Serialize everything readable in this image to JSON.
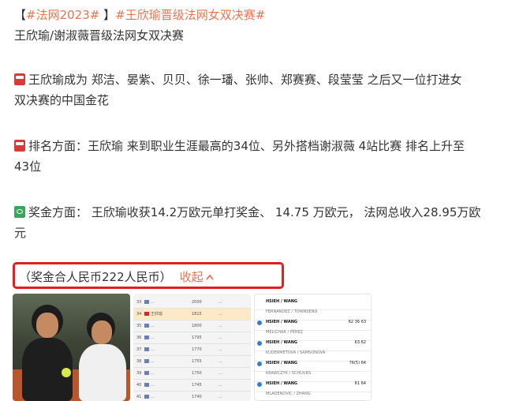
{
  "post": {
    "tag_open": "【",
    "tag_1": "#法网2023#",
    "tag_close": "】",
    "tag_2": "#王欣瑜晋级法网女双决赛#",
    "headline": "王欣瑜/谢淑薇晋级法网女双决赛",
    "para1_line1": "王欣瑜成为 郑洁、晏紫、贝贝、徐一璠、张帅、郑赛赛、段莹莹 之后又一位打进女",
    "para1_line2": "双决赛的中国金花",
    "para2_line1": "排名方面：王欣瑜 来到职业生涯最高的34位、另外搭档谢淑薇 4站比赛 排名上升至",
    "para2_line2": "43位",
    "para3_line1": "奖金方面： 王欣瑜收获14.2万欧元单打奖金、 14.75 万欧元， 法网总收入28.95万欧",
    "para3_line2": "元",
    "note": "（奖金合人民币222人民币）",
    "collapse_label": "收起",
    "icons": {
      "para1": "red-bookmark-icon",
      "para2": "red-bookmark-icon",
      "para3": "money-icon",
      "collapse": "chevron-up-icon"
    },
    "colors": {
      "link": "#eb7350",
      "highlight_box": "#e02020",
      "text": "#333333"
    }
  },
  "thumbnails": {
    "ranking": {
      "rows": [
        {
          "rank": "33",
          "name": "...",
          "pts": "2000",
          "note": "..."
        },
        {
          "rank": "34",
          "name": "王欣瑜",
          "pts": "1815",
          "note": "...",
          "highlight": true
        },
        {
          "rank": "35",
          "name": "...",
          "pts": "1800",
          "note": "..."
        },
        {
          "rank": "36",
          "name": "...",
          "pts": "1795",
          "note": "..."
        },
        {
          "rank": "37",
          "name": "...",
          "pts": "1770",
          "note": "..."
        },
        {
          "rank": "38",
          "name": "...",
          "pts": "1755",
          "note": "..."
        },
        {
          "rank": "39",
          "name": "...",
          "pts": "1750",
          "note": "..."
        },
        {
          "rank": "40",
          "name": "...",
          "pts": "1745",
          "note": "..."
        },
        {
          "rank": "41",
          "name": "...",
          "pts": "1740",
          "note": "..."
        }
      ]
    },
    "results": {
      "rows": [
        {
          "team": "HSIEH / WANG",
          "score": "",
          "bold": true,
          "check": false
        },
        {
          "team": "FERNANDEZ / TOWNSEND",
          "score": "",
          "bold": false,
          "check": false
        },
        {
          "team": "HSIEH / WANG",
          "score": "62 36 63",
          "bold": true,
          "check": true
        },
        {
          "team": "MELICHAR / PEREZ",
          "score": "",
          "bold": false,
          "check": false
        },
        {
          "team": "HSIEH / WANG",
          "score": "63 62",
          "bold": true,
          "check": true
        },
        {
          "team": "KUDERMETOVA / SAMSONOVA",
          "score": "",
          "bold": false,
          "check": false
        },
        {
          "team": "HSIEH / WANG",
          "score": "76(5) 64",
          "bold": true,
          "check": true
        },
        {
          "team": "KRAWCZYK / SCHUURS",
          "score": "",
          "bold": false,
          "check": false
        },
        {
          "team": "HSIEH / WANG",
          "score": "61 64",
          "bold": true,
          "check": true
        },
        {
          "team": "MLADENOVIC / ZHANG",
          "score": "",
          "bold": false,
          "check": false
        }
      ]
    }
  }
}
